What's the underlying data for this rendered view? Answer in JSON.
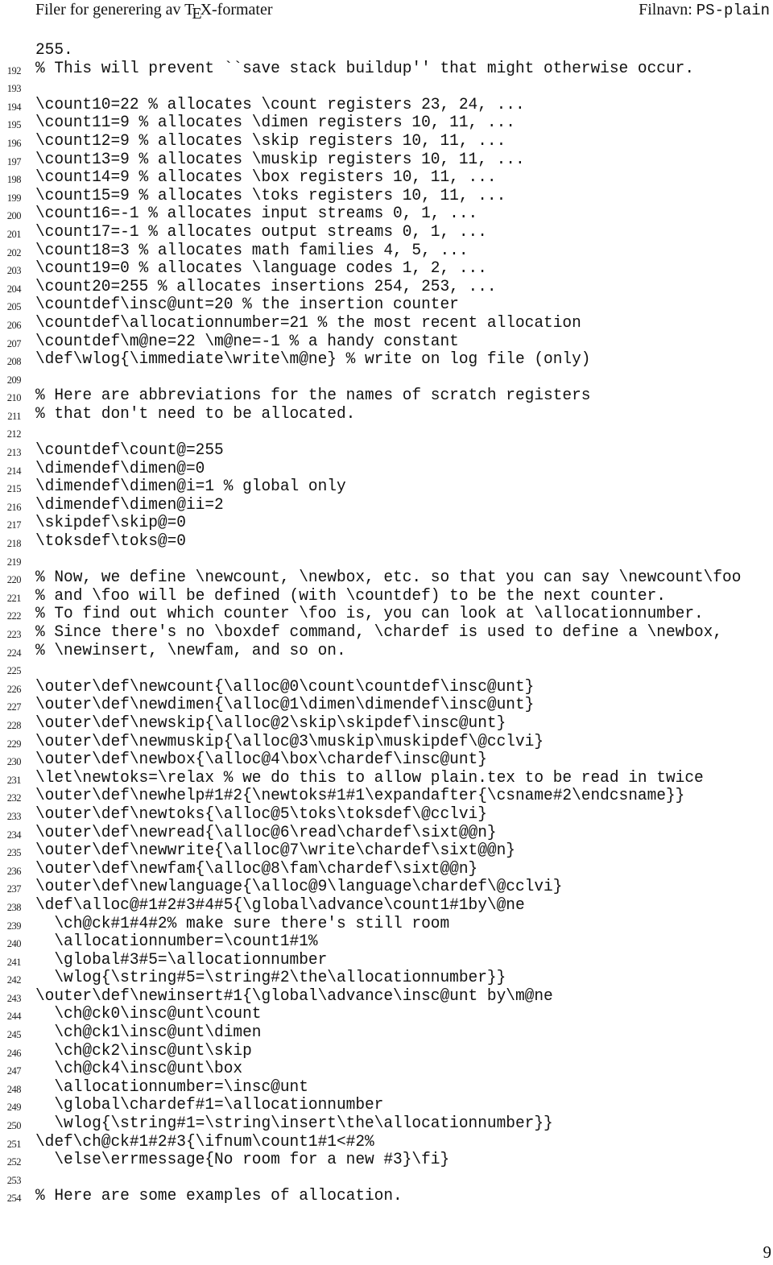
{
  "header": {
    "title_prefix": "Filer for generering av T",
    "title_tex_e": "E",
    "title_suffix": "X-formater",
    "filename_label": "Filnavn: ",
    "filename_value": "PS-plain"
  },
  "code_lines": [
    {
      "num": "",
      "text": "255."
    },
    {
      "num": "192",
      "text": "% This will prevent ``save stack buildup'' that might otherwise occur."
    },
    {
      "num": "193",
      "text": ""
    },
    {
      "num": "194",
      "text": "\\count10=22 % allocates \\count registers 23, 24, ..."
    },
    {
      "num": "195",
      "text": "\\count11=9 % allocates \\dimen registers 10, 11, ..."
    },
    {
      "num": "196",
      "text": "\\count12=9 % allocates \\skip registers 10, 11, ..."
    },
    {
      "num": "197",
      "text": "\\count13=9 % allocates \\muskip registers 10, 11, ..."
    },
    {
      "num": "198",
      "text": "\\count14=9 % allocates \\box registers 10, 11, ..."
    },
    {
      "num": "199",
      "text": "\\count15=9 % allocates \\toks registers 10, 11, ..."
    },
    {
      "num": "200",
      "text": "\\count16=-1 % allocates input streams 0, 1, ..."
    },
    {
      "num": "201",
      "text": "\\count17=-1 % allocates output streams 0, 1, ..."
    },
    {
      "num": "202",
      "text": "\\count18=3 % allocates math families 4, 5, ..."
    },
    {
      "num": "203",
      "text": "\\count19=0 % allocates \\language codes 1, 2, ..."
    },
    {
      "num": "204",
      "text": "\\count20=255 % allocates insertions 254, 253, ..."
    },
    {
      "num": "205",
      "text": "\\countdef\\insc@unt=20 % the insertion counter"
    },
    {
      "num": "206",
      "text": "\\countdef\\allocationnumber=21 % the most recent allocation"
    },
    {
      "num": "207",
      "text": "\\countdef\\m@ne=22 \\m@ne=-1 % a handy constant"
    },
    {
      "num": "208",
      "text": "\\def\\wlog{\\immediate\\write\\m@ne} % write on log file (only)"
    },
    {
      "num": "209",
      "text": ""
    },
    {
      "num": "210",
      "text": "% Here are abbreviations for the names of scratch registers"
    },
    {
      "num": "211",
      "text": "% that don't need to be allocated."
    },
    {
      "num": "212",
      "text": ""
    },
    {
      "num": "213",
      "text": "\\countdef\\count@=255"
    },
    {
      "num": "214",
      "text": "\\dimendef\\dimen@=0"
    },
    {
      "num": "215",
      "text": "\\dimendef\\dimen@i=1 % global only"
    },
    {
      "num": "216",
      "text": "\\dimendef\\dimen@ii=2"
    },
    {
      "num": "217",
      "text": "\\skipdef\\skip@=0"
    },
    {
      "num": "218",
      "text": "\\toksdef\\toks@=0"
    },
    {
      "num": "219",
      "text": ""
    },
    {
      "num": "220",
      "text": "% Now, we define \\newcount, \\newbox, etc. so that you can say \\newcount\\foo"
    },
    {
      "num": "221",
      "text": "% and \\foo will be defined (with \\countdef) to be the next counter."
    },
    {
      "num": "222",
      "text": "% To find out which counter \\foo is, you can look at \\allocationnumber."
    },
    {
      "num": "223",
      "text": "% Since there's no \\boxdef command, \\chardef is used to define a \\newbox,"
    },
    {
      "num": "224",
      "text": "% \\newinsert, \\newfam, and so on."
    },
    {
      "num": "225",
      "text": ""
    },
    {
      "num": "226",
      "text": "\\outer\\def\\newcount{\\alloc@0\\count\\countdef\\insc@unt}"
    },
    {
      "num": "227",
      "text": "\\outer\\def\\newdimen{\\alloc@1\\dimen\\dimendef\\insc@unt}"
    },
    {
      "num": "228",
      "text": "\\outer\\def\\newskip{\\alloc@2\\skip\\skipdef\\insc@unt}"
    },
    {
      "num": "229",
      "text": "\\outer\\def\\newmuskip{\\alloc@3\\muskip\\muskipdef\\@cclvi}"
    },
    {
      "num": "230",
      "text": "\\outer\\def\\newbox{\\alloc@4\\box\\chardef\\insc@unt}"
    },
    {
      "num": "231",
      "text": "\\let\\newtoks=\\relax % we do this to allow plain.tex to be read in twice"
    },
    {
      "num": "232",
      "text": "\\outer\\def\\newhelp#1#2{\\newtoks#1#1\\expandafter{\\csname#2\\endcsname}}"
    },
    {
      "num": "233",
      "text": "\\outer\\def\\newtoks{\\alloc@5\\toks\\toksdef\\@cclvi}"
    },
    {
      "num": "234",
      "text": "\\outer\\def\\newread{\\alloc@6\\read\\chardef\\sixt@@n}"
    },
    {
      "num": "235",
      "text": "\\outer\\def\\newwrite{\\alloc@7\\write\\chardef\\sixt@@n}"
    },
    {
      "num": "236",
      "text": "\\outer\\def\\newfam{\\alloc@8\\fam\\chardef\\sixt@@n}"
    },
    {
      "num": "237",
      "text": "\\outer\\def\\newlanguage{\\alloc@9\\language\\chardef\\@cclvi}"
    },
    {
      "num": "238",
      "text": "\\def\\alloc@#1#2#3#4#5{\\global\\advance\\count1#1by\\@ne"
    },
    {
      "num": "239",
      "text": "  \\ch@ck#1#4#2% make sure there's still room"
    },
    {
      "num": "240",
      "text": "  \\allocationnumber=\\count1#1%"
    },
    {
      "num": "241",
      "text": "  \\global#3#5=\\allocationnumber"
    },
    {
      "num": "242",
      "text": "  \\wlog{\\string#5=\\string#2\\the\\allocationnumber}}"
    },
    {
      "num": "243",
      "text": "\\outer\\def\\newinsert#1{\\global\\advance\\insc@unt by\\m@ne"
    },
    {
      "num": "244",
      "text": "  \\ch@ck0\\insc@unt\\count"
    },
    {
      "num": "245",
      "text": "  \\ch@ck1\\insc@unt\\dimen"
    },
    {
      "num": "246",
      "text": "  \\ch@ck2\\insc@unt\\skip"
    },
    {
      "num": "247",
      "text": "  \\ch@ck4\\insc@unt\\box"
    },
    {
      "num": "248",
      "text": "  \\allocationnumber=\\insc@unt"
    },
    {
      "num": "249",
      "text": "  \\global\\chardef#1=\\allocationnumber"
    },
    {
      "num": "250",
      "text": "  \\wlog{\\string#1=\\string\\insert\\the\\allocationnumber}}"
    },
    {
      "num": "251",
      "text": "\\def\\ch@ck#1#2#3{\\ifnum\\count1#1<#2%"
    },
    {
      "num": "252",
      "text": "  \\else\\errmessage{No room for a new #3}\\fi}"
    },
    {
      "num": "253",
      "text": ""
    },
    {
      "num": "254",
      "text": "% Here are some examples of allocation."
    }
  ],
  "footer": {
    "page_number": "9"
  }
}
